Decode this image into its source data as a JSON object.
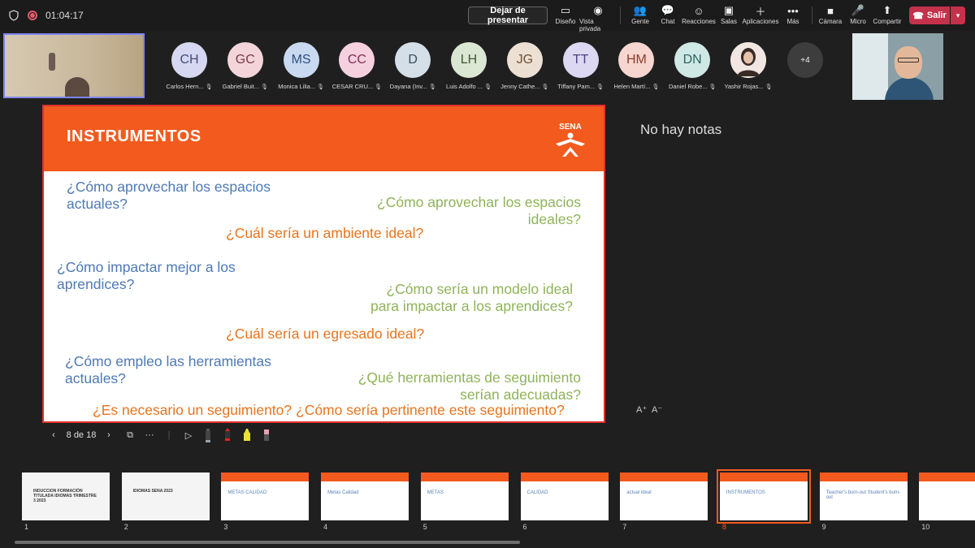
{
  "topbar": {
    "timer": "01:04:17",
    "stop_presenting": "Dejar de presentar",
    "tools": [
      {
        "label": "Diseño",
        "icon": "layout-icon"
      },
      {
        "label": "Vista privada",
        "icon": "eye-icon"
      },
      {
        "label": "Gente",
        "icon": "people-icon"
      },
      {
        "label": "Chat",
        "icon": "chat-icon"
      },
      {
        "label": "Reacciones",
        "icon": "reactions-icon"
      },
      {
        "label": "Salas",
        "icon": "rooms-icon"
      },
      {
        "label": "Aplicaciones",
        "icon": "plus-icon"
      },
      {
        "label": "Más",
        "icon": "more-icon"
      },
      {
        "label": "Cámara",
        "icon": "camera-icon"
      },
      {
        "label": "Micro",
        "icon": "mic-off-icon"
      },
      {
        "label": "Compartir",
        "icon": "share-icon"
      }
    ],
    "leave": "Salir"
  },
  "participants": [
    {
      "initials": "CH",
      "name": "Carlos Hern...",
      "bg": "#d5d8f0",
      "fg": "#444a7a"
    },
    {
      "initials": "GC",
      "name": "Gabriel Buit...",
      "bg": "#f3d5d9",
      "fg": "#7a3a44"
    },
    {
      "initials": "MS",
      "name": "Monica Lilia...",
      "bg": "#c8d9f0",
      "fg": "#2f4f80"
    },
    {
      "initials": "CC",
      "name": "CESAR CRU...",
      "bg": "#f5d0df",
      "fg": "#803050"
    },
    {
      "initials": "D",
      "name": "Dayana (Inv...",
      "bg": "#d4dfe8",
      "fg": "#3a4e60"
    },
    {
      "initials": "LH",
      "name": "Luis Adolfo ...",
      "bg": "#dbe6d3",
      "fg": "#3e5a32"
    },
    {
      "initials": "JG",
      "name": "Jenny Cathe...",
      "bg": "#ece0d3",
      "fg": "#6b5236"
    },
    {
      "initials": "TT",
      "name": "Tiffany Pam...",
      "bg": "#dcd8f2",
      "fg": "#4a437e"
    },
    {
      "initials": "HM",
      "name": "Helen Martí...",
      "bg": "#f6d6cf",
      "fg": "#8a3d2c"
    },
    {
      "initials": "DN",
      "name": "Daniel Robe...",
      "bg": "#cfe8e6",
      "fg": "#2b6660"
    },
    {
      "initials": "",
      "name": "Yashir Rojas...",
      "bg": "#e9d6d6",
      "fg": "#333"
    }
  ],
  "more_participants": "+4",
  "slide": {
    "title": "INSTRUMENTOS",
    "logo_text": "SENA",
    "questions": [
      {
        "lines": [
          "¿Cómo aprovechar los espacios",
          "actuales?"
        ],
        "color": "blue"
      },
      {
        "lines": [
          "¿Cómo aprovechar los espacios",
          "ideales?"
        ],
        "color": "green"
      },
      {
        "lines": [
          "¿Cuál sería un ambiente ideal?"
        ],
        "color": "orange"
      },
      {
        "lines": [
          "¿Cómo impactar mejor a los",
          "aprendices?"
        ],
        "color": "blue"
      },
      {
        "lines": [
          "¿Cómo sería un modelo ideal",
          "para impactar a los aprendices?"
        ],
        "color": "green"
      },
      {
        "lines": [
          "¿Cuál sería un egresado ideal?"
        ],
        "color": "orange"
      },
      {
        "lines": [
          "¿Cómo empleo las herramientas",
          "actuales?"
        ],
        "color": "blue"
      },
      {
        "lines": [
          "¿Qué herramientas de seguimiento",
          "serían adecuadas?"
        ],
        "color": "green"
      },
      {
        "lines": [
          "¿Es necesario un seguimiento? ¿Cómo sería pertinente este seguimiento?"
        ],
        "color": "orange"
      }
    ]
  },
  "notes": {
    "empty_text": "No hay notas",
    "increase_font": "A⁺",
    "decrease_font": "A⁻"
  },
  "slide_nav": {
    "counter": "8 de 18"
  },
  "thumbnails": [
    {
      "num": "1",
      "text": "INDUCCION FORMACIÓN TITULADA IDIOMAS TRIMESTRE 3 2023",
      "type": "title"
    },
    {
      "num": "2",
      "text": "IDIOMAS SENA 2023",
      "type": "title2"
    },
    {
      "num": "3",
      "text": "METAS  CALIDAD",
      "type": "orange"
    },
    {
      "num": "4",
      "text": "Metas  Calidad",
      "type": "orange"
    },
    {
      "num": "5",
      "text": "METAS",
      "type": "orange"
    },
    {
      "num": "6",
      "text": "CALIDAD",
      "type": "orange"
    },
    {
      "num": "7",
      "text": "actual  ideal",
      "type": "orange"
    },
    {
      "num": "8",
      "text": "INSTRUMENTOS",
      "type": "orange"
    },
    {
      "num": "9",
      "text": "Teacher's burn-out  Student's burn-out",
      "type": "orange"
    },
    {
      "num": "10",
      "text": "",
      "type": "orange"
    }
  ]
}
